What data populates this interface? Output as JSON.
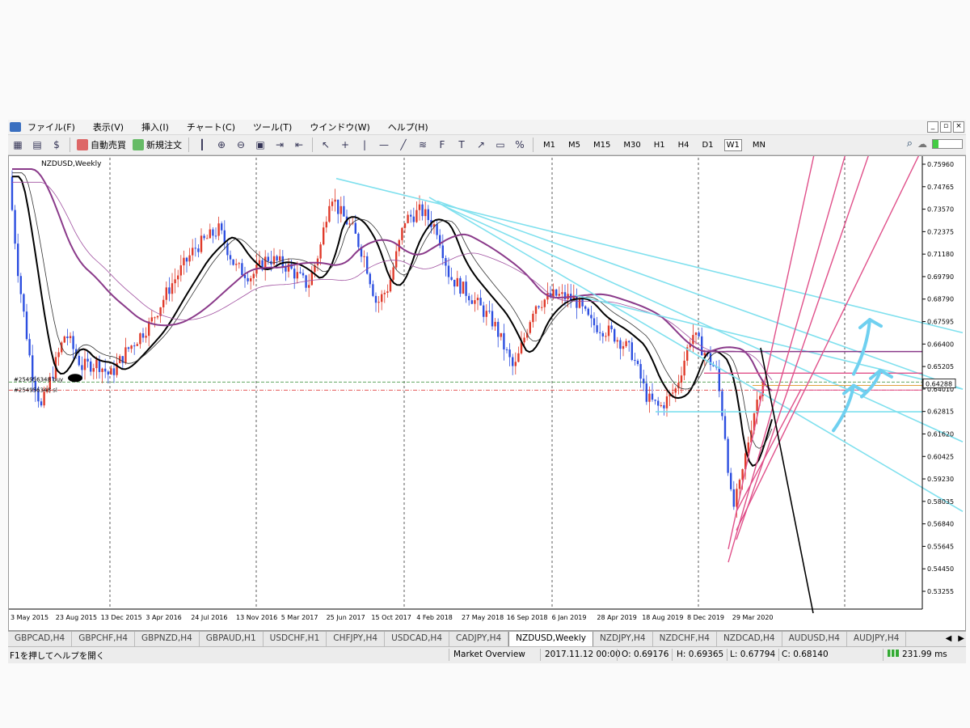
{
  "menu": [
    "ファイル(F)",
    "表示(V)",
    "挿入(I)",
    "チャート(C)",
    "ツール(T)",
    "ウインドウ(W)",
    "ヘルプ(H)"
  ],
  "toolbar": {
    "auto_trade": "自動売買",
    "new_order": "新規注文",
    "timeframes": [
      "M1",
      "M5",
      "M15",
      "M30",
      "H1",
      "H4",
      "D1",
      "W1",
      "MN"
    ],
    "active_timeframe": "W1"
  },
  "chart": {
    "title": "NZDUSD,Weekly",
    "current_price": "0.64288",
    "order_labels": [
      "#254956348 buy",
      "#254956348 sl"
    ],
    "price_axis": [
      "0.75960",
      "0.74765",
      "0.73570",
      "0.72375",
      "0.71180",
      "0.69790",
      "0.68790",
      "0.67595",
      "0.66400",
      "0.65205",
      "0.64010",
      "0.62815",
      "0.61620",
      "0.60425",
      "0.59230",
      "0.58035",
      "0.56840",
      "0.55645",
      "0.54450",
      "0.53255"
    ],
    "date_axis": [
      "3 May 2015",
      "23 Aug 2015",
      "13 Dec 2015",
      "3 Apr 2016",
      "24 Jul 2016",
      "13 Nov 2016",
      "5 Mar 2017",
      "25 Jun 2017",
      "15 Oct 2017",
      "4 Feb 2018",
      "27 May 2018",
      "16 Sep 2018",
      "6 Jan 2019",
      "28 Apr 2019",
      "18 Aug 2019",
      "8 Dec 2019",
      "29 Mar 2020"
    ],
    "colors": {
      "bull": "#e03a2a",
      "bear": "#2d4fe0",
      "trend": "#7fe0ee",
      "pink": "#e0508a",
      "purple": "#8a3a8a",
      "arrow": "#6fd0f0"
    }
  },
  "tabs": [
    "GBPCAD,H4",
    "GBPCHF,H4",
    "GBPNZD,H4",
    "GBPAUD,H1",
    "USDCHF,H1",
    "CHFJPY,H4",
    "USDCAD,H4",
    "CADJPY,H4",
    "NZDUSD,Weekly",
    "NZDJPY,H4",
    "NZDCHF,H4",
    "NZDCAD,H4",
    "AUDUSD,H4",
    "AUDJPY,H4"
  ],
  "active_tab": "NZDUSD,Weekly",
  "status": {
    "help": "F1を押してヘルプを開く",
    "profile": "Market Overview",
    "datetime": "2017.11.12 00:00",
    "open": "O: 0.69176",
    "high": "H: 0.69365",
    "low": "L: 0.67794",
    "close": "C: 0.68140",
    "ping": "231.99 ms"
  }
}
